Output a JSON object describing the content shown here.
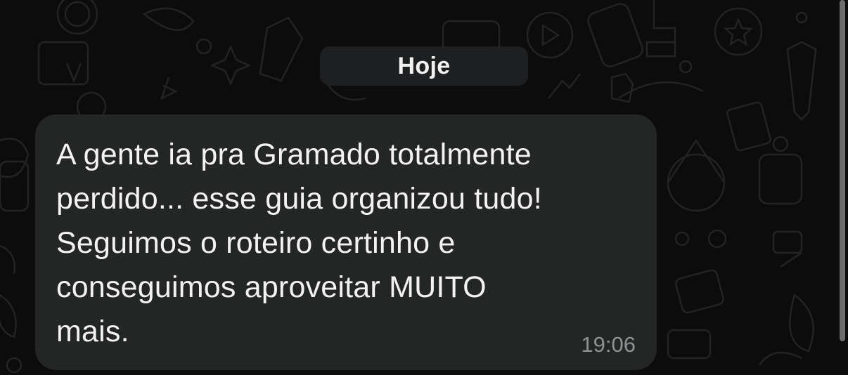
{
  "chat": {
    "date_separator": "Hoje",
    "messages": [
      {
        "text": "A gente ia pra Gramado totalmente\nperdido... esse guia organizou tudo!\nSeguimos o roteiro certinho e\nconseguimos aproveitar MUITO\nmais.",
        "time": "19:06",
        "direction": "incoming"
      }
    ]
  },
  "theme": {
    "background": "#0c0c0d",
    "bubble": "#242626",
    "date_pill": "#1d1f20",
    "text": "#f2f2f2",
    "time_text": "#8f9294"
  }
}
